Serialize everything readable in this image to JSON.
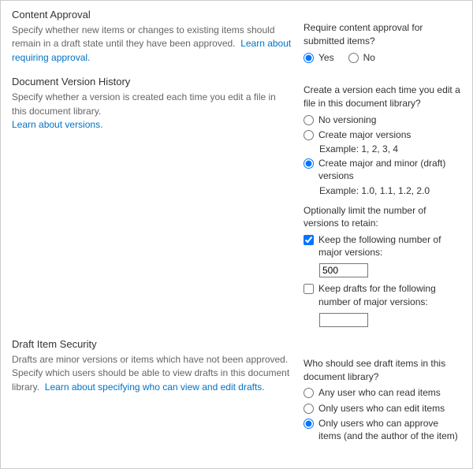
{
  "contentApproval": {
    "title": "Content Approval",
    "desc": "Specify whether new items or changes to existing items should remain in a draft state until they have been approved.",
    "link": "Learn about requiring approval.",
    "question": "Require content approval for submitted items?",
    "yes": "Yes",
    "no": "No"
  },
  "versionHistory": {
    "title": "Document Version History",
    "desc": "Specify whether a version is created each time you edit a file in this document library.",
    "link": "Learn about versions.",
    "q1": "Create a version each time you edit a file in this document library?",
    "optNone": "No versioning",
    "optMajor": "Create major versions",
    "exMajor": "Example: 1, 2, 3, 4",
    "optMinor": "Create major and minor (draft) versions",
    "exMinor": "Example: 1.0, 1.1, 1.2, 2.0",
    "q2": "Optionally limit the number of versions to retain:",
    "keepMajor": "Keep the following number of major versions:",
    "keepMajorValue": "500",
    "keepDrafts": "Keep drafts for the following number of major versions:",
    "keepDraftsValue": ""
  },
  "draftSecurity": {
    "title": "Draft Item Security",
    "desc": "Drafts are minor versions or items which have not been approved. Specify which users should be able to view drafts in this document library.",
    "link": "Learn about specifying who can view and edit drafts.",
    "question": "Who should see draft items in this document library?",
    "optRead": "Any user who can read items",
    "optEdit": "Only users who can edit items",
    "optApprove": "Only users who can approve items (and the author of the item)"
  }
}
